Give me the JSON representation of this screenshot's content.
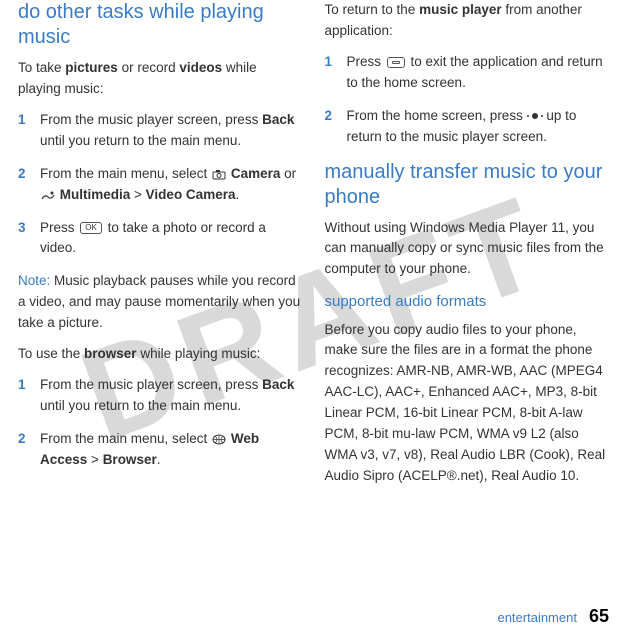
{
  "watermark": "DRAFT",
  "left": {
    "heading": "do other tasks while playing music",
    "intro_pre": "To take ",
    "intro_b1": "pictures",
    "intro_mid": " or record ",
    "intro_b2": "videos",
    "intro_post": " while playing music:",
    "steps_a": [
      {
        "num": "1",
        "pre": "From the music player screen, press ",
        "key": "Back",
        "post": " until you return to the main menu."
      },
      {
        "num": "2",
        "pre": "From the main menu, select ",
        "icon1": "camera",
        "label1": "Camera",
        "mid": " or ",
        "icon2": "multimedia",
        "label2": "Multimedia",
        "gt": " > ",
        "label3": "Video Camera",
        "post": "."
      },
      {
        "num": "3",
        "pre": "Press ",
        "key": "OK",
        "post": " to take a photo or record a video."
      }
    ],
    "note_label": "Note:",
    "note_text": " Music playback pauses while you record a video, and may pause momentarily when you take a picture.",
    "browser_intro_pre": "To use the ",
    "browser_intro_b": "browser",
    "browser_intro_post": " while playing music:",
    "steps_b": [
      {
        "num": "1",
        "pre": "From the music player screen, press ",
        "key": "Back",
        "post": " until you return to the main menu."
      },
      {
        "num": "2",
        "pre": "From the main menu, select ",
        "icon1": "web",
        "label1": "Web Access",
        "gt": " > ",
        "label2": "Browser",
        "post": "."
      }
    ]
  },
  "right": {
    "return_intro_pre": "To return to the ",
    "return_intro_b": "music player",
    "return_intro_post": " from another application:",
    "steps_c": [
      {
        "num": "1",
        "pre": "Press ",
        "key": "home",
        "post": " to exit the application and return to the home screen."
      },
      {
        "num": "2",
        "pre": "From the home screen, press ",
        "key": "nav",
        "post": " up to return to the music player screen."
      }
    ],
    "heading2": "manually transfer music to your phone",
    "para2": "Without using Windows Media Player 11, you can manually copy or sync music files from the computer to your phone.",
    "subheading": "supported audio formats",
    "para3": "Before you copy audio files to your phone, make sure the files are in a format the phone recognizes: AMR-NB, AMR-WB, AAC (MPEG4 AAC-LC), AAC+, Enhanced AAC+, MP3, 8-bit Linear PCM, 16-bit Linear PCM, 8-bit A-law PCM, 8-bit mu-law PCM, WMA v9 L2 (also WMA v3, v7, v8), Real Audio LBR (Cook), Real Audio Sipro (ACELP®.net), Real Audio 10."
  },
  "footer": {
    "label": "entertainment",
    "page": "65"
  }
}
